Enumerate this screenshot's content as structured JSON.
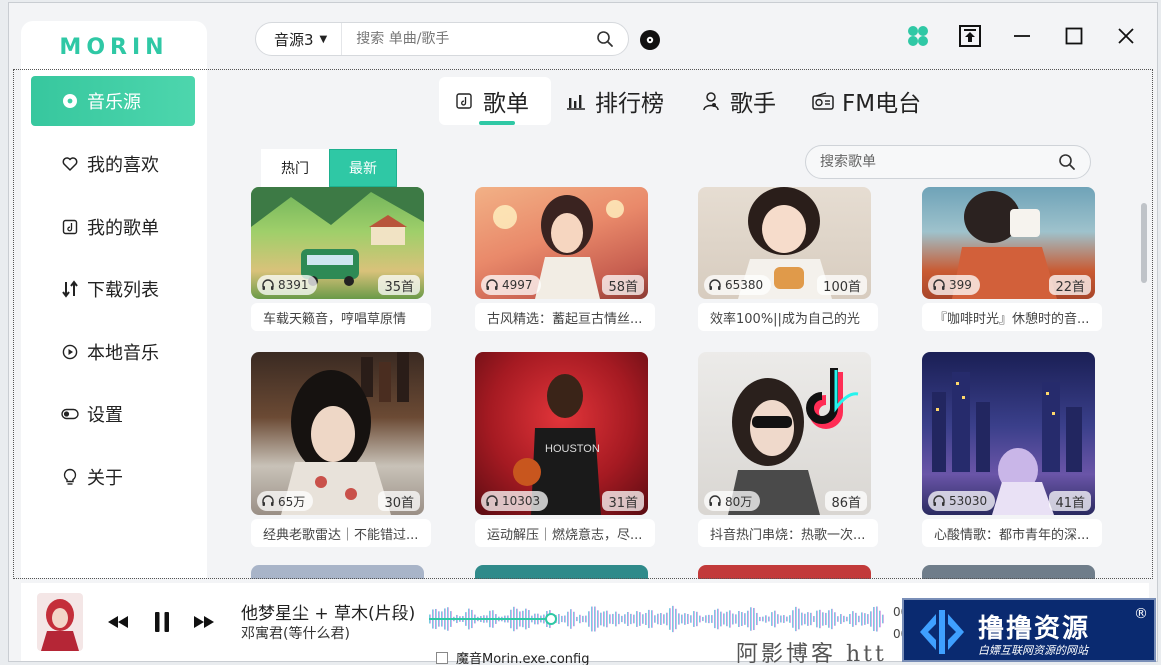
{
  "app": {
    "logo": "MORIN"
  },
  "search": {
    "source": "音源3",
    "placeholder": "搜索 单曲/歌手"
  },
  "sidebar": {
    "items": [
      {
        "label": "音乐源",
        "icon": "disc-icon",
        "active": true
      },
      {
        "label": "我的喜欢",
        "icon": "heart-icon"
      },
      {
        "label": "我的歌单",
        "icon": "playlist-icon"
      },
      {
        "label": "下载列表",
        "icon": "download-sort-icon"
      },
      {
        "label": "本地音乐",
        "icon": "play-circle-icon"
      },
      {
        "label": "设置",
        "icon": "toggle-icon"
      },
      {
        "label": "关于",
        "icon": "lightbulb-icon"
      }
    ]
  },
  "tabs": [
    {
      "label": "歌单",
      "icon": "playlist-icon",
      "active": true
    },
    {
      "label": "排行榜",
      "icon": "bar-chart-icon"
    },
    {
      "label": "歌手",
      "icon": "singer-icon"
    },
    {
      "label": "FM电台",
      "icon": "radio-icon"
    }
  ],
  "filter": {
    "hot": "热门",
    "newest": "最新",
    "active": "newest",
    "search_placeholder": "搜索歌单"
  },
  "playlists": [
    {
      "plays": "8391",
      "count": "35首",
      "title": "车载天籁音，哼唱草原情"
    },
    {
      "plays": "4997",
      "count": "58首",
      "title": "古风精选：蓄起亘古情丝..."
    },
    {
      "plays": "65380",
      "count": "100首",
      "title": "效率100%||成为自己的光"
    },
    {
      "plays": "399",
      "count": "22首",
      "title": "『咖啡时光』休憩时的音..."
    },
    {
      "plays": "65万",
      "count": "30首",
      "title": "经典老歌雷达｜不能错过..."
    },
    {
      "plays": "10303",
      "count": "31首",
      "title": "运动解压｜燃烧意志，尽..."
    },
    {
      "plays": "80万",
      "count": "86首",
      "title": "抖音热门串烧：热歌一次..."
    },
    {
      "plays": "53030",
      "count": "41首",
      "title": "心酸情歌：都市青年的深..."
    }
  ],
  "player": {
    "title": "他梦星尘 + 草木(片段)",
    "artist": "邓寓君(等什么君)",
    "time": "00:",
    "time2": "00:"
  },
  "overlay": {
    "badge_main": "撸撸资源",
    "badge_sub": "白嫖互联网资源的网站",
    "badge_reg": "®",
    "blog": "阿影博客 htt",
    "behind_file": "魔音Morin.exe.config"
  },
  "colors": {
    "accent": "#2fc8a5",
    "accent_dark": "#1eb08e"
  }
}
